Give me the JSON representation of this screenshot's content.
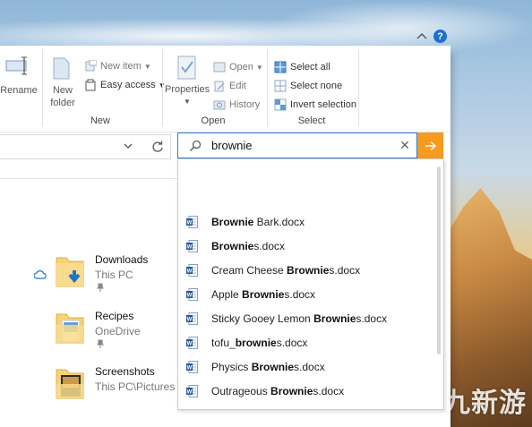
{
  "window": {
    "controls": {
      "minimize": "—",
      "maximize": "☐",
      "close": "✕"
    },
    "help": "?"
  },
  "ribbon": {
    "clipboard": {
      "rename": "Rename"
    },
    "new_group": {
      "label": "New",
      "new_folder_line1": "New",
      "new_folder_line2": "folder",
      "new_item": "New item",
      "easy_access": "Easy access"
    },
    "open_group": {
      "label": "Open",
      "properties": "Properties",
      "open": "Open",
      "edit": "Edit",
      "history": "History"
    },
    "select_group": {
      "label": "Select",
      "select_all": "Select all",
      "select_none": "Select none",
      "invert_selection": "Invert selection"
    }
  },
  "search": {
    "value": "brownie",
    "clear": "✕"
  },
  "quick_access": [
    {
      "title": "Downloads",
      "subtitle": "This PC",
      "icon": "downloads-folder-icon"
    },
    {
      "title": "Recipes",
      "subtitle": "OneDrive",
      "icon": "recipes-folder-icon"
    },
    {
      "title": "Screenshots",
      "subtitle": "This PC\\Pictures",
      "icon": "screenshots-folder-icon"
    }
  ],
  "suggestions": [
    {
      "pre": "",
      "match": "Brownie",
      "post": " Bark.docx"
    },
    {
      "pre": "",
      "match": "Brownie",
      "post": "s.docx"
    },
    {
      "pre": "Cream Cheese ",
      "match": "Brownie",
      "post": "s.docx"
    },
    {
      "pre": "Apple ",
      "match": "Brownie",
      "post": "s.docx"
    },
    {
      "pre": "Sticky Gooey Lemon ",
      "match": "Brownie",
      "post": "s.docx"
    },
    {
      "pre": "tofu_",
      "match": "brownie",
      "post": "s.docx"
    },
    {
      "pre": "Physics ",
      "match": "Brownie",
      "post": "s.docx"
    },
    {
      "pre": "Outrageous ",
      "match": "Brownie",
      "post": "s.docx"
    }
  ],
  "watermark": "傅九新游",
  "colors": {
    "accent": "#f79a1e",
    "word_blue": "#2b579a",
    "focus_blue": "#2f7bd8"
  }
}
